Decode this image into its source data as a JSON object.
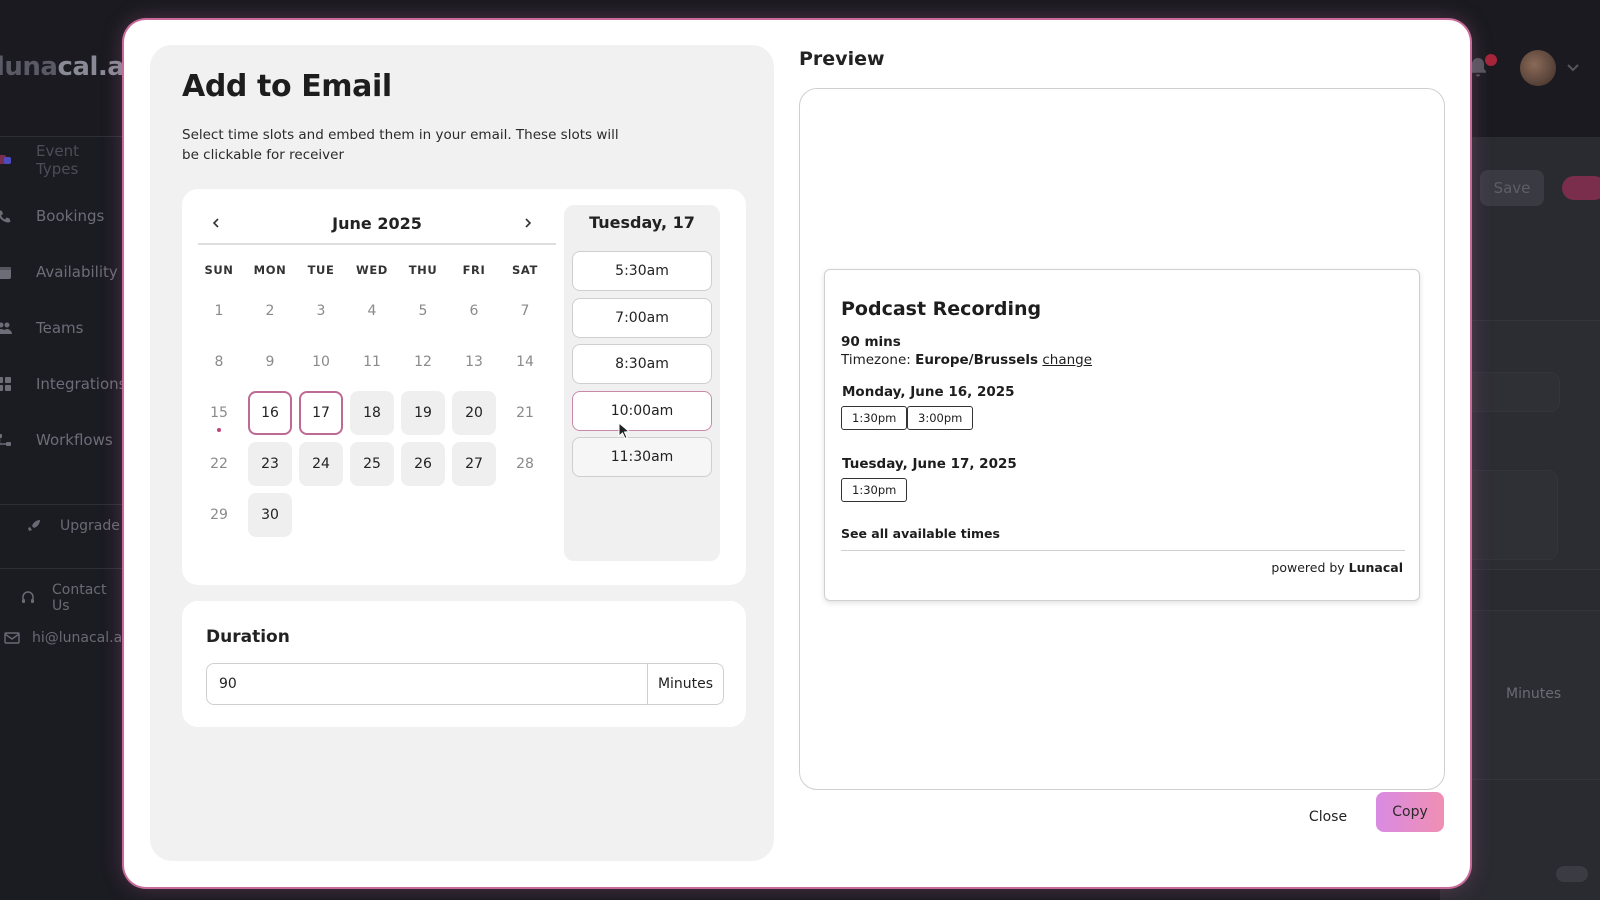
{
  "background": {
    "logo_prefix": "luna",
    "logo_suffix": "cal.a",
    "sidebar": [
      {
        "label": "Event Types",
        "icon": "event-types-icon"
      },
      {
        "label": "Bookings",
        "icon": "phone-icon"
      },
      {
        "label": "Availability",
        "icon": "calendar-icon"
      },
      {
        "label": "Teams",
        "icon": "users-icon"
      },
      {
        "label": "Integrations",
        "icon": "grid-icon"
      },
      {
        "label": "Workflows",
        "icon": "workflow-icon"
      }
    ],
    "upgrade": "Upgrade",
    "contact": "Contact Us",
    "email": "hi@lunacal.ai",
    "save_label": "Save",
    "minutes_label": "Minutes"
  },
  "modal": {
    "title": "Add to Email",
    "subtitle": "Select time slots and embed them in your email. These slots will be clickable for receiver",
    "calendar": {
      "month": "June 2025",
      "weekdays": [
        "SUN",
        "MON",
        "TUE",
        "WED",
        "THU",
        "FRI",
        "SAT"
      ],
      "days": [
        {
          "n": "1",
          "state": "disabled"
        },
        {
          "n": "2",
          "state": "disabled"
        },
        {
          "n": "3",
          "state": "disabled"
        },
        {
          "n": "4",
          "state": "disabled"
        },
        {
          "n": "5",
          "state": "disabled"
        },
        {
          "n": "6",
          "state": "disabled"
        },
        {
          "n": "7",
          "state": "disabled"
        },
        {
          "n": "8",
          "state": "disabled"
        },
        {
          "n": "9",
          "state": "disabled"
        },
        {
          "n": "10",
          "state": "disabled"
        },
        {
          "n": "11",
          "state": "disabled"
        },
        {
          "n": "12",
          "state": "disabled"
        },
        {
          "n": "13",
          "state": "disabled"
        },
        {
          "n": "14",
          "state": "disabled"
        },
        {
          "n": "15",
          "state": "today"
        },
        {
          "n": "16",
          "state": "selected"
        },
        {
          "n": "17",
          "state": "selected"
        },
        {
          "n": "18",
          "state": "available"
        },
        {
          "n": "19",
          "state": "available"
        },
        {
          "n": "20",
          "state": "available"
        },
        {
          "n": "21",
          "state": "disabled"
        },
        {
          "n": "22",
          "state": "disabled"
        },
        {
          "n": "23",
          "state": "available"
        },
        {
          "n": "24",
          "state": "available"
        },
        {
          "n": "25",
          "state": "available"
        },
        {
          "n": "26",
          "state": "available"
        },
        {
          "n": "27",
          "state": "available"
        },
        {
          "n": "28",
          "state": "disabled"
        },
        {
          "n": "29",
          "state": "disabled"
        },
        {
          "n": "30",
          "state": "available"
        }
      ],
      "selected_day_title": "Tuesday, 17",
      "slots": [
        {
          "time": "5:30am",
          "state": "normal"
        },
        {
          "time": "7:00am",
          "state": "normal"
        },
        {
          "time": "8:30am",
          "state": "normal"
        },
        {
          "time": "10:00am",
          "state": "selected"
        },
        {
          "time": "11:30am",
          "state": "hover"
        }
      ]
    },
    "duration": {
      "label": "Duration",
      "value": "90",
      "unit": "Minutes"
    },
    "preview": {
      "heading": "Preview",
      "event_title": "Podcast Recording",
      "length": "90 mins",
      "timezone_label": "Timezone:",
      "timezone": "Europe/Brussels",
      "change_link": "change",
      "days": [
        {
          "date": "Monday, June 16, 2025",
          "slots": [
            "1:30pm",
            "3:00pm"
          ]
        },
        {
          "date": "Tuesday, June 17, 2025",
          "slots": [
            "1:30pm"
          ]
        }
      ],
      "see_all": "See all available times",
      "powered_prefix": "powered by",
      "powered_brand": "Lunacal"
    },
    "buttons": {
      "close": "Close",
      "copy": "Copy"
    }
  },
  "colors": {
    "accent": "#bd6a95",
    "copy_gradient_start": "#d98be3",
    "copy_gradient_end": "#f08fb3"
  }
}
